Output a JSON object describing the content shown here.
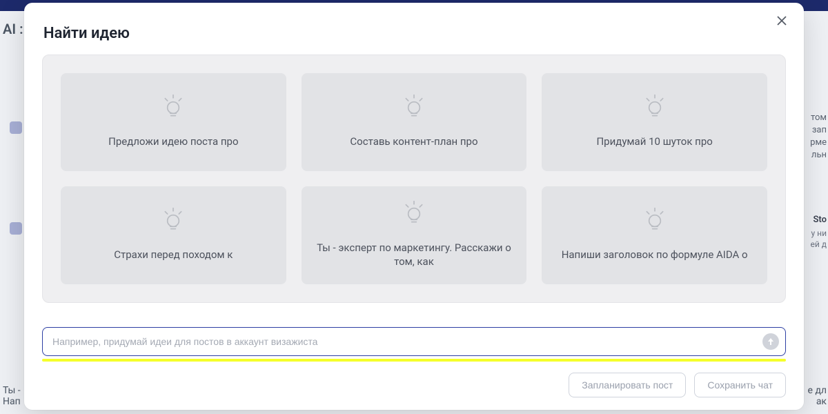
{
  "bg": {
    "topleft": "AI :",
    "right_block1": "том\nзап\nрме\nльн",
    "right_block2_title": "Sto",
    "right_block2_body": "у ни\nей д",
    "bottom_left": "Ты -\nНап",
    "bottom_right": "е дл\nак"
  },
  "modal": {
    "title": "Найти идею",
    "close_aria": "Закрыть",
    "cards": [
      {
        "label": "Предложи идею поста про"
      },
      {
        "label": "Составь контент-план про"
      },
      {
        "label": "Придумай 10 шуток про"
      },
      {
        "label": "Страхи перед походом к"
      },
      {
        "label": "Ты - эксперт по маркетингу. Расскажи о том, как"
      },
      {
        "label": "Напиши заголовок по формуле AIDA о"
      }
    ],
    "input": {
      "placeholder": "Например, придумай идеи для постов в аккаунт визажиста",
      "value": ""
    },
    "buttons": {
      "schedule": "Запланировать пост",
      "save": "Сохранить чат"
    }
  }
}
